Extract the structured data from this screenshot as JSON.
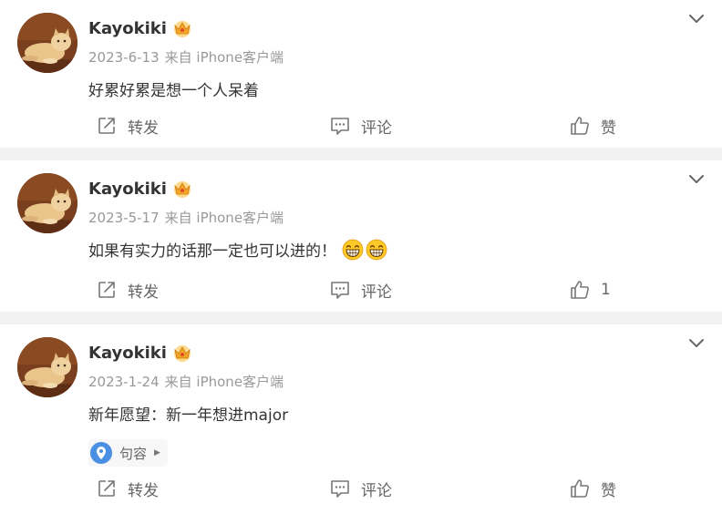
{
  "posts": [
    {
      "username": "Kayokiki",
      "date": "2023-6-13",
      "source": "来自 iPhone客户端",
      "text": "好累好累是想一个人呆着",
      "emojis": [],
      "location": null,
      "actions": {
        "repost": "转发",
        "comment": "评论",
        "like": "赞"
      }
    },
    {
      "username": "Kayokiki",
      "date": "2023-5-17",
      "source": "来自 iPhone客户端",
      "text": "如果有实力的话那一定也可以进的！",
      "emojis": [
        "grin-emoji",
        "grin-emoji"
      ],
      "location": null,
      "actions": {
        "repost": "转发",
        "comment": "评论",
        "like": "1"
      }
    },
    {
      "username": "Kayokiki",
      "date": "2023-1-24",
      "source": "来自 iPhone客户端",
      "text": "新年愿望：新一年想进major",
      "emojis": [],
      "location": "句容",
      "actions": {
        "repost": "转发",
        "comment": "评论",
        "like": "赞"
      }
    }
  ],
  "colors": {
    "text": "#333333",
    "meta": "#999999",
    "action": "#666666",
    "divider": "#f2f2f2",
    "location_pin": "#4a90e2",
    "vip_badge": "#f5a623"
  },
  "icons": {
    "menu": "chevron-down-icon",
    "repost": "share-icon",
    "comment": "comment-icon",
    "like": "thumbs-up-icon",
    "location": "location-pin-icon",
    "badge": "vip-crown-icon"
  }
}
